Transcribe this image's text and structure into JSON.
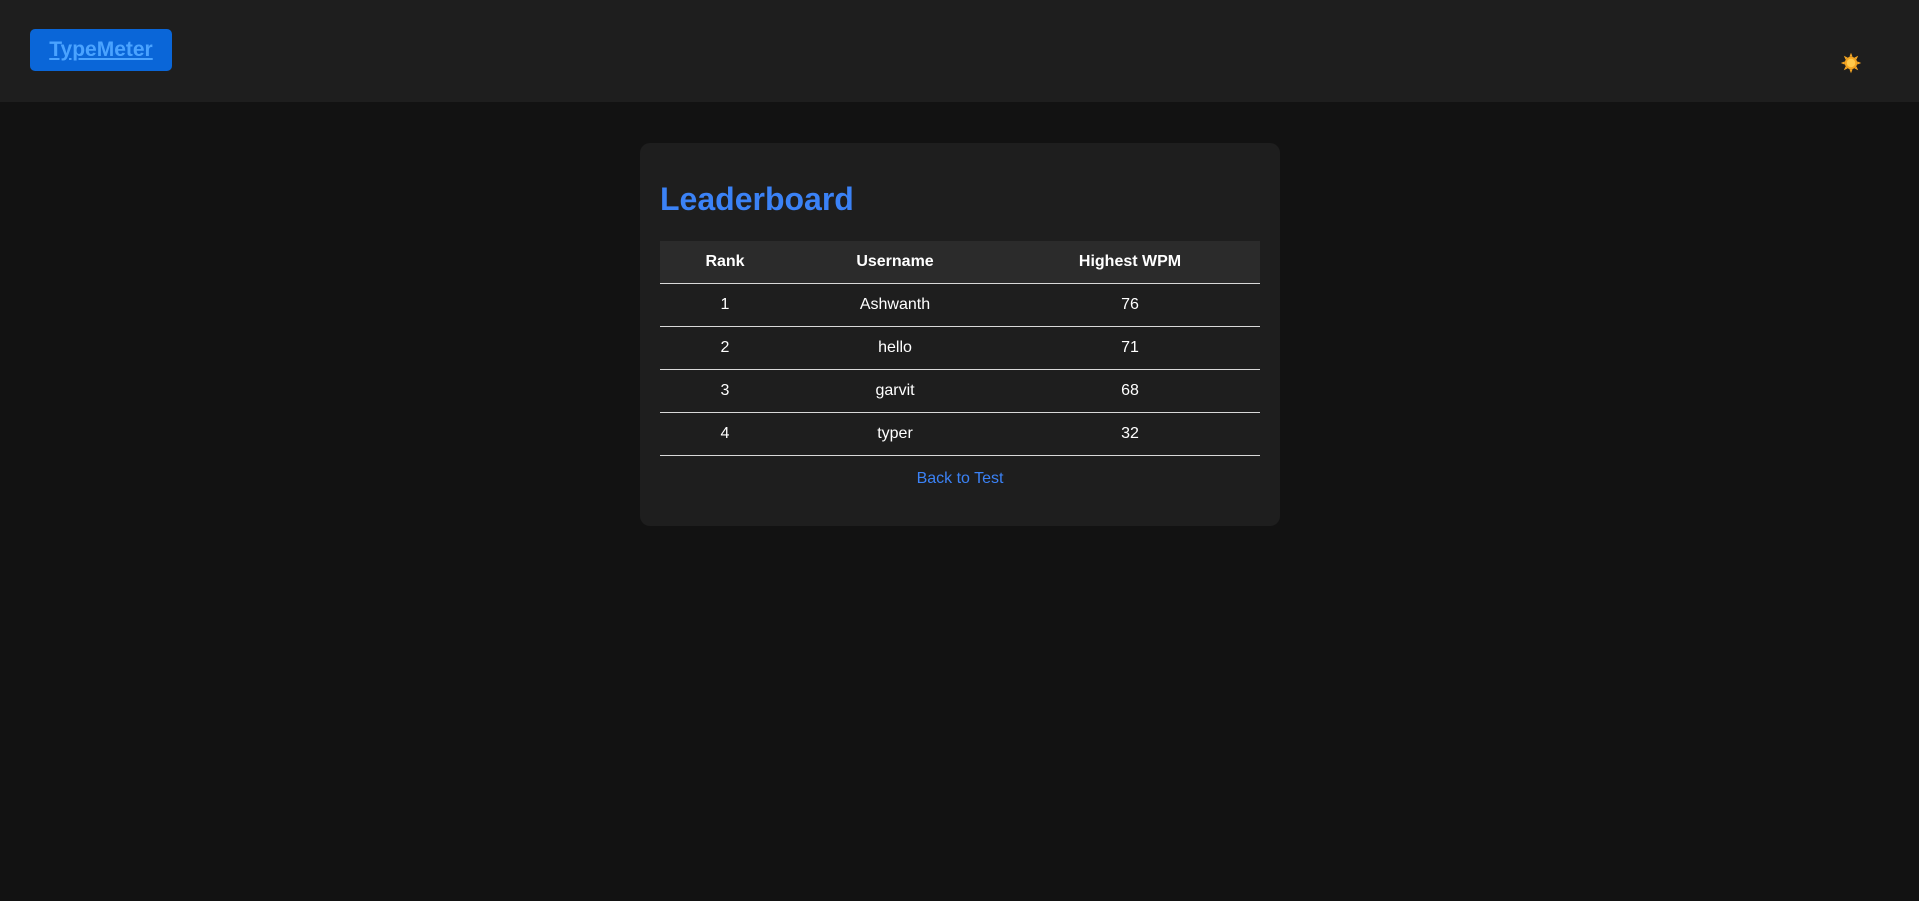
{
  "nav": {
    "brand": "TypeMeter",
    "theme_icon": "sun-icon"
  },
  "leaderboard": {
    "title": "Leaderboard",
    "columns": [
      "Rank",
      "Username",
      "Highest WPM"
    ],
    "rows": [
      [
        "1",
        "Ashwanth",
        "76"
      ],
      [
        "2",
        "hello",
        "71"
      ],
      [
        "3",
        "garvit",
        "68"
      ],
      [
        "4",
        "typer",
        "32"
      ]
    ],
    "back_link": "Back to Test"
  },
  "colors": {
    "accent": "#3b82f6",
    "brand_bg": "#0a66d8",
    "page_bg": "#121212",
    "card_bg": "#1e1e1e",
    "sun": "#f5a623"
  }
}
